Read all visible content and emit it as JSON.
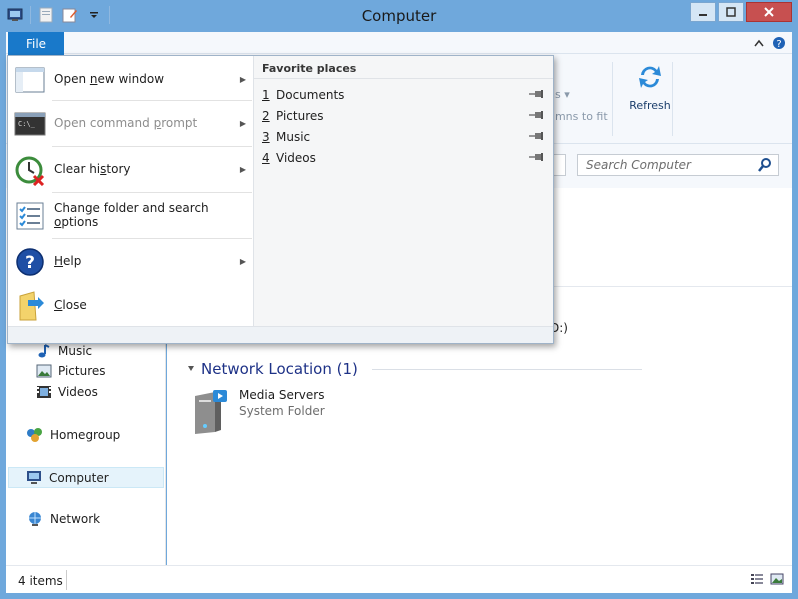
{
  "window": {
    "title": "Computer",
    "colors": {
      "accent": "#1979ca",
      "frame": "#6fa8dc"
    }
  },
  "ribbon": {
    "file_tab": "File",
    "partial_label_1": "ns",
    "partial_label_2": "umns to fit",
    "refresh_label": "Refresh"
  },
  "search": {
    "placeholder": "Search Computer"
  },
  "file_menu": {
    "items": [
      {
        "label": "Open new window",
        "enabled": true,
        "has_submenu": true,
        "icon": "new-window-icon"
      },
      {
        "label": "Open command prompt",
        "enabled": false,
        "has_submenu": true,
        "icon": "command-prompt-icon"
      },
      {
        "label": "Clear history",
        "enabled": true,
        "has_submenu": true,
        "icon": "clear-history-icon"
      },
      {
        "label": "Change folder and search options",
        "enabled": true,
        "has_submenu": false,
        "icon": "folder-options-icon"
      },
      {
        "label": "Help",
        "enabled": true,
        "has_submenu": true,
        "icon": "help-icon"
      },
      {
        "label": "Close",
        "enabled": true,
        "has_submenu": false,
        "icon": "close-folder-icon"
      }
    ],
    "favorites_header": "Favorite places",
    "favorites": [
      {
        "num": "1",
        "label": "Documents"
      },
      {
        "num": "2",
        "label": "Pictures"
      },
      {
        "num": "3",
        "label": "Music"
      },
      {
        "num": "4",
        "label": "Videos"
      }
    ]
  },
  "nav": {
    "items": [
      {
        "label": "Music",
        "icon": "music-icon"
      },
      {
        "label": "Pictures",
        "icon": "pictures-icon"
      },
      {
        "label": "Videos",
        "icon": "videos-icon"
      },
      {
        "label": "Homegroup",
        "icon": "homegroup-icon"
      },
      {
        "label": "Computer",
        "icon": "computer-icon",
        "selected": true
      },
      {
        "label": "Network",
        "icon": "network-icon"
      }
    ]
  },
  "content": {
    "drive_label_partial": "D:)",
    "group_header": "Network Location (1)",
    "item": {
      "name": "Media Servers",
      "type": "System Folder"
    }
  },
  "status": {
    "count": "4 items"
  }
}
